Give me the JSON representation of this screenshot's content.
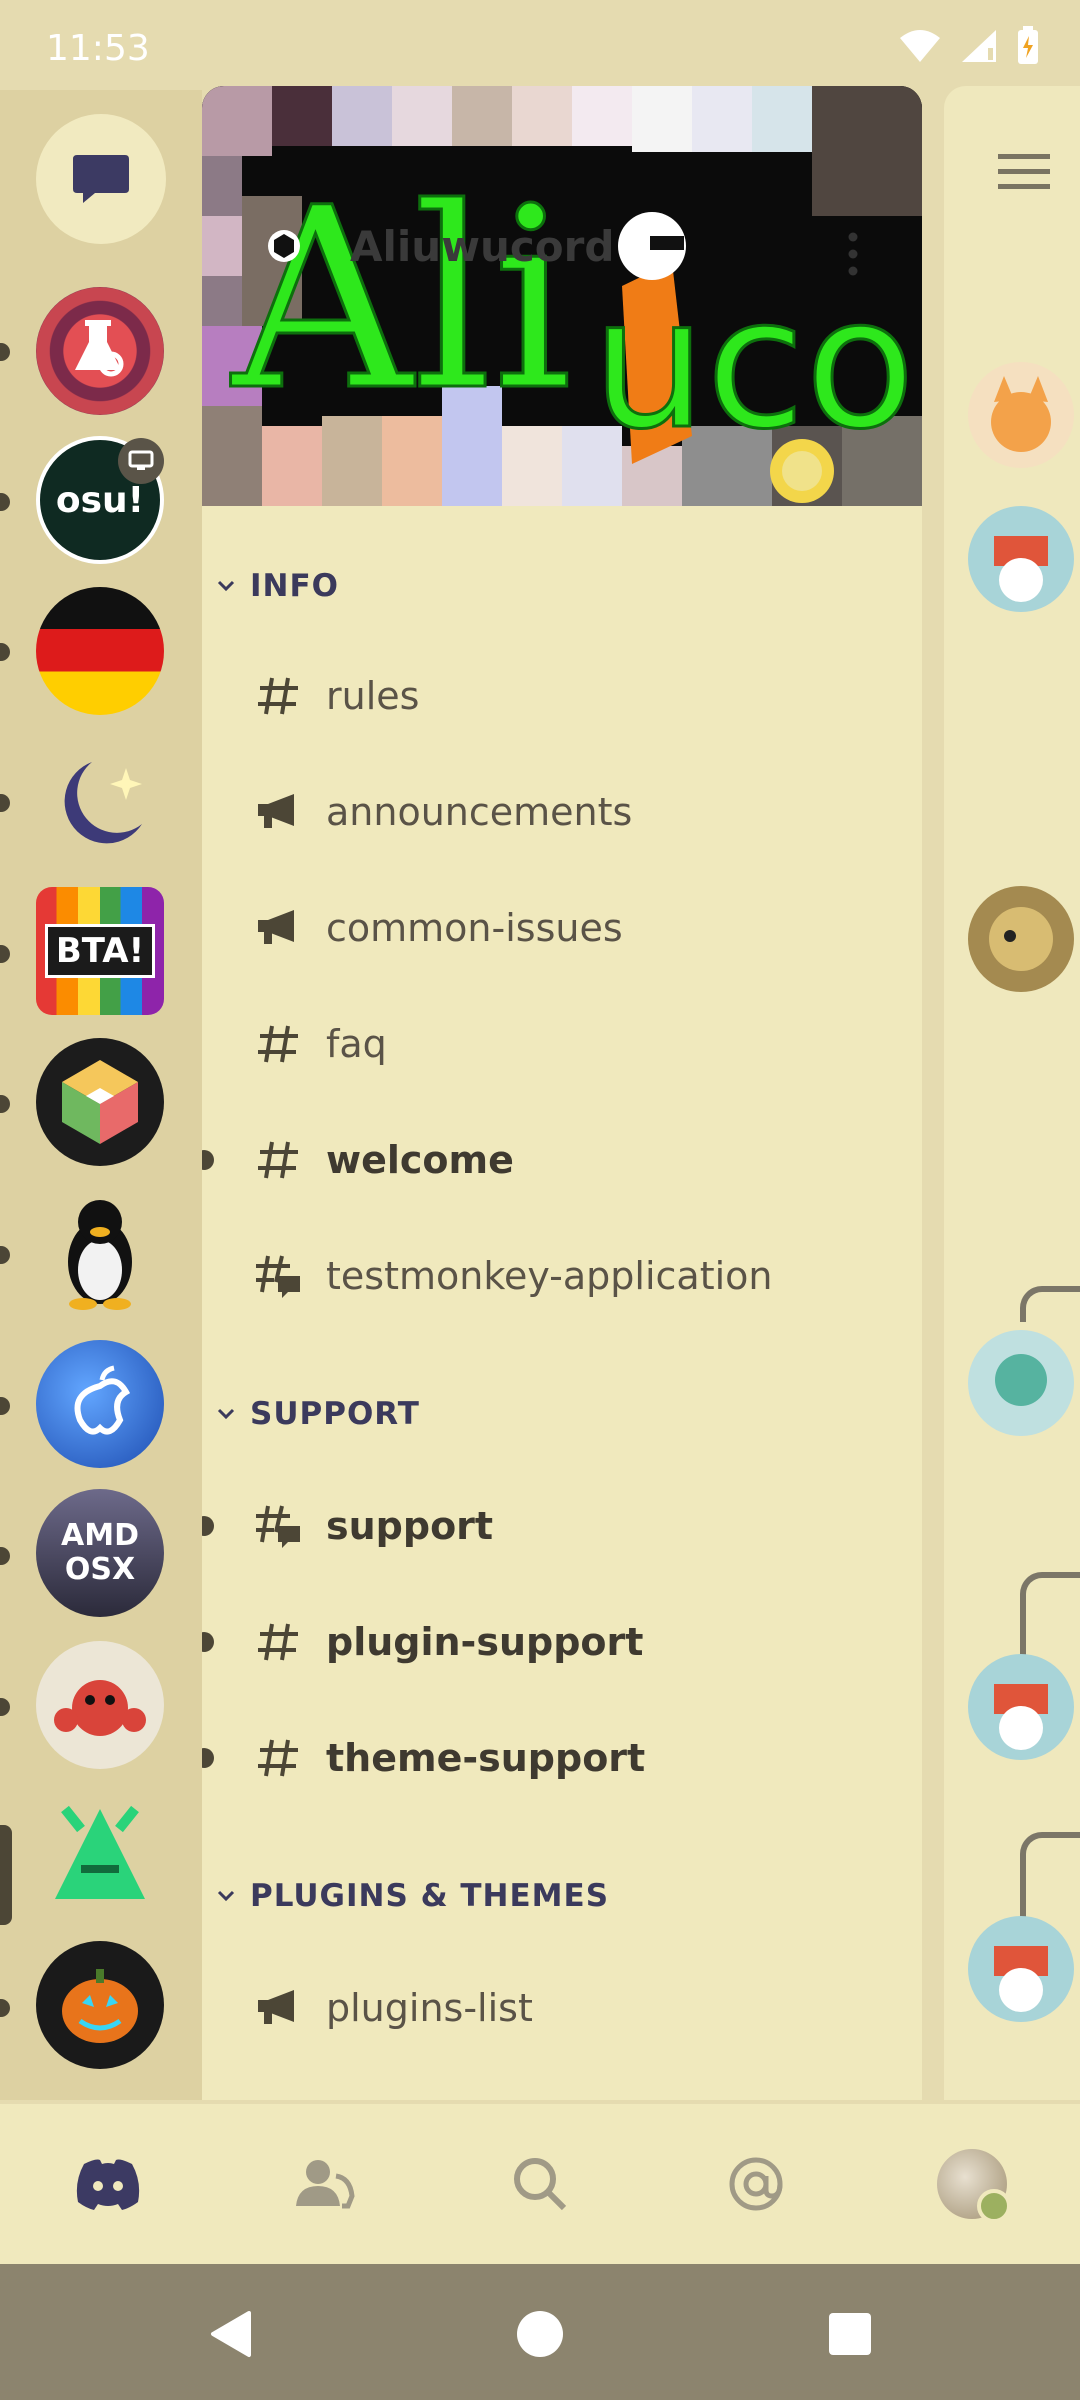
{
  "status_bar": {
    "time": "11:53",
    "icons": [
      "wifi-icon",
      "signal-icon",
      "battery-icon"
    ]
  },
  "server_rail": {
    "direct_messages_icon": "chat-bubble-icon",
    "servers": [
      "lab-flask-server",
      "osu-server",
      "germany-flag-server",
      "moon-star-server",
      "bta-server",
      "cube-server",
      "linux-penguin-server",
      "apple-swirl-server",
      "amd-osx-server",
      "crab-server",
      "aliucord-logo-server",
      "pumpkin-server"
    ]
  },
  "guild": {
    "name": "Aliuwucord",
    "banner_text": "Aliucord"
  },
  "categories": [
    {
      "name": "INFO",
      "channels": [
        {
          "name": "rules",
          "icon": "hash-icon",
          "unread": false
        },
        {
          "name": "announcements",
          "icon": "megaphone-icon",
          "unread": false
        },
        {
          "name": "common-issues",
          "icon": "megaphone-icon",
          "unread": false
        },
        {
          "name": "faq",
          "icon": "hash-icon",
          "unread": false
        },
        {
          "name": "welcome",
          "icon": "hash-icon",
          "unread": true
        },
        {
          "name": "testmonkey-application",
          "icon": "forum-icon",
          "unread": false
        }
      ]
    },
    {
      "name": "SUPPORT",
      "channels": [
        {
          "name": "support",
          "icon": "forum-icon",
          "unread": true
        },
        {
          "name": "plugin-support",
          "icon": "hash-icon",
          "unread": true
        },
        {
          "name": "theme-support",
          "icon": "hash-icon",
          "unread": true
        }
      ]
    },
    {
      "name": "PLUGINS & THEMES",
      "channels": [
        {
          "name": "plugins-list",
          "icon": "megaphone-icon",
          "unread": false
        }
      ]
    }
  ],
  "bottom_tabs": [
    "discord-home-icon",
    "friends-icon",
    "search-icon",
    "mentions-icon",
    "profile-avatar"
  ],
  "nav_bar": [
    "back-icon",
    "home-icon",
    "recents-icon"
  ],
  "colors": {
    "background": "#e5dbb0",
    "drawer": "#f0e9bd",
    "text": "#3e3b32",
    "category": "#3b3a5c",
    "banner_logo_green": "#2ee81c",
    "banner_logo_orange": "#f07c16"
  }
}
